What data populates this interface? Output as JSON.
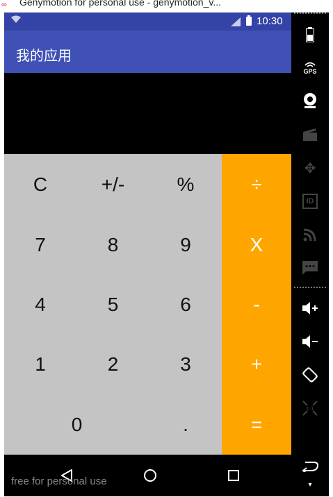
{
  "window": {
    "title": "Genymotion for personal use - genymotion_v..."
  },
  "statusbar": {
    "time": "10:30"
  },
  "app": {
    "title": "我的应用"
  },
  "calculator": {
    "display": "",
    "keys": {
      "clear": "C",
      "sign": "+/-",
      "percent": "%",
      "divide": "÷",
      "seven": "7",
      "eight": "8",
      "nine": "9",
      "multiply": "X",
      "four": "4",
      "five": "5",
      "six": "6",
      "minus": "-",
      "one": "1",
      "two": "2",
      "three": "3",
      "plus": "+",
      "zero": "0",
      "dot": ".",
      "equals": "="
    },
    "colors": {
      "keypad": "#c4c4c4",
      "operators": "#ffa500",
      "appbar": "#3f51b5"
    }
  },
  "watermark": "free for personal use",
  "sidepanel": {
    "gps_label": "GPS",
    "id_label": "ID"
  }
}
